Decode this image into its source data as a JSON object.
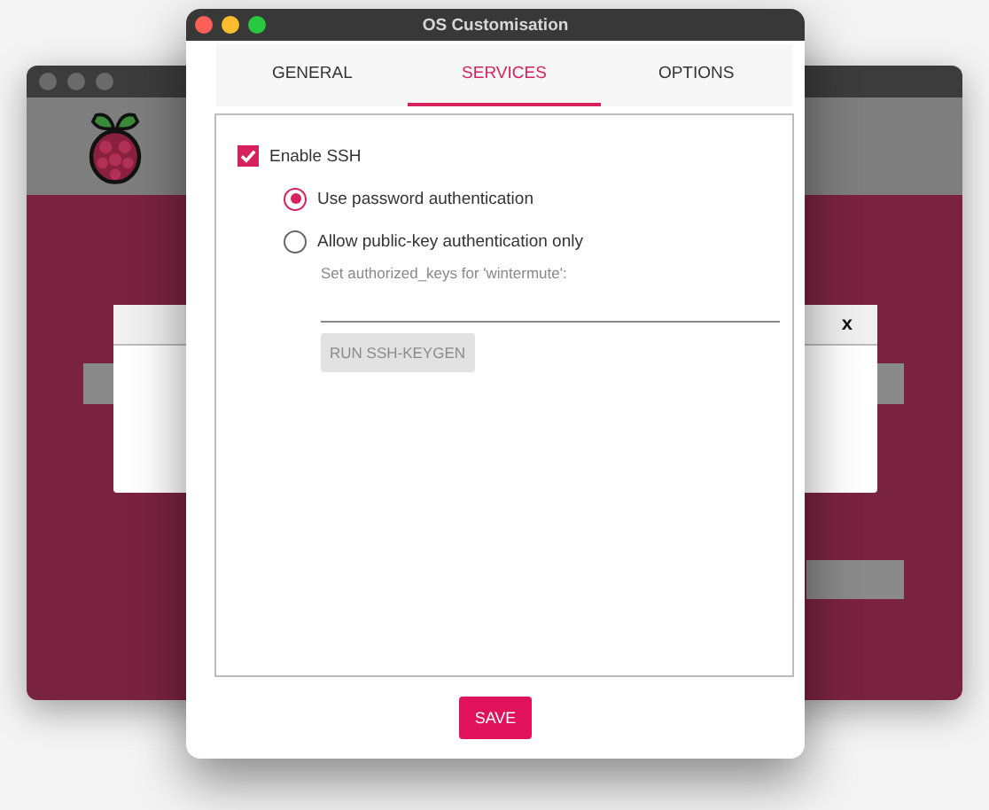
{
  "background_window": {
    "dialog": {
      "close": "x"
    }
  },
  "window": {
    "title": "OS Customisation"
  },
  "tabs": [
    {
      "label": "GENERAL",
      "selected": false
    },
    {
      "label": "SERVICES",
      "selected": true
    },
    {
      "label": "OPTIONS",
      "selected": false
    }
  ],
  "ssh": {
    "label": "Enable SSH",
    "checked": true,
    "options": [
      {
        "label": "Use password authentication",
        "selected": true
      },
      {
        "label": "Allow public-key authentication only",
        "selected": false
      }
    ],
    "keys_label": "Set authorized_keys for 'wintermute':",
    "keygen_button": {
      "label": "RUN SSH-KEYGEN",
      "disabled": true
    }
  },
  "save_button": "SAVE"
}
